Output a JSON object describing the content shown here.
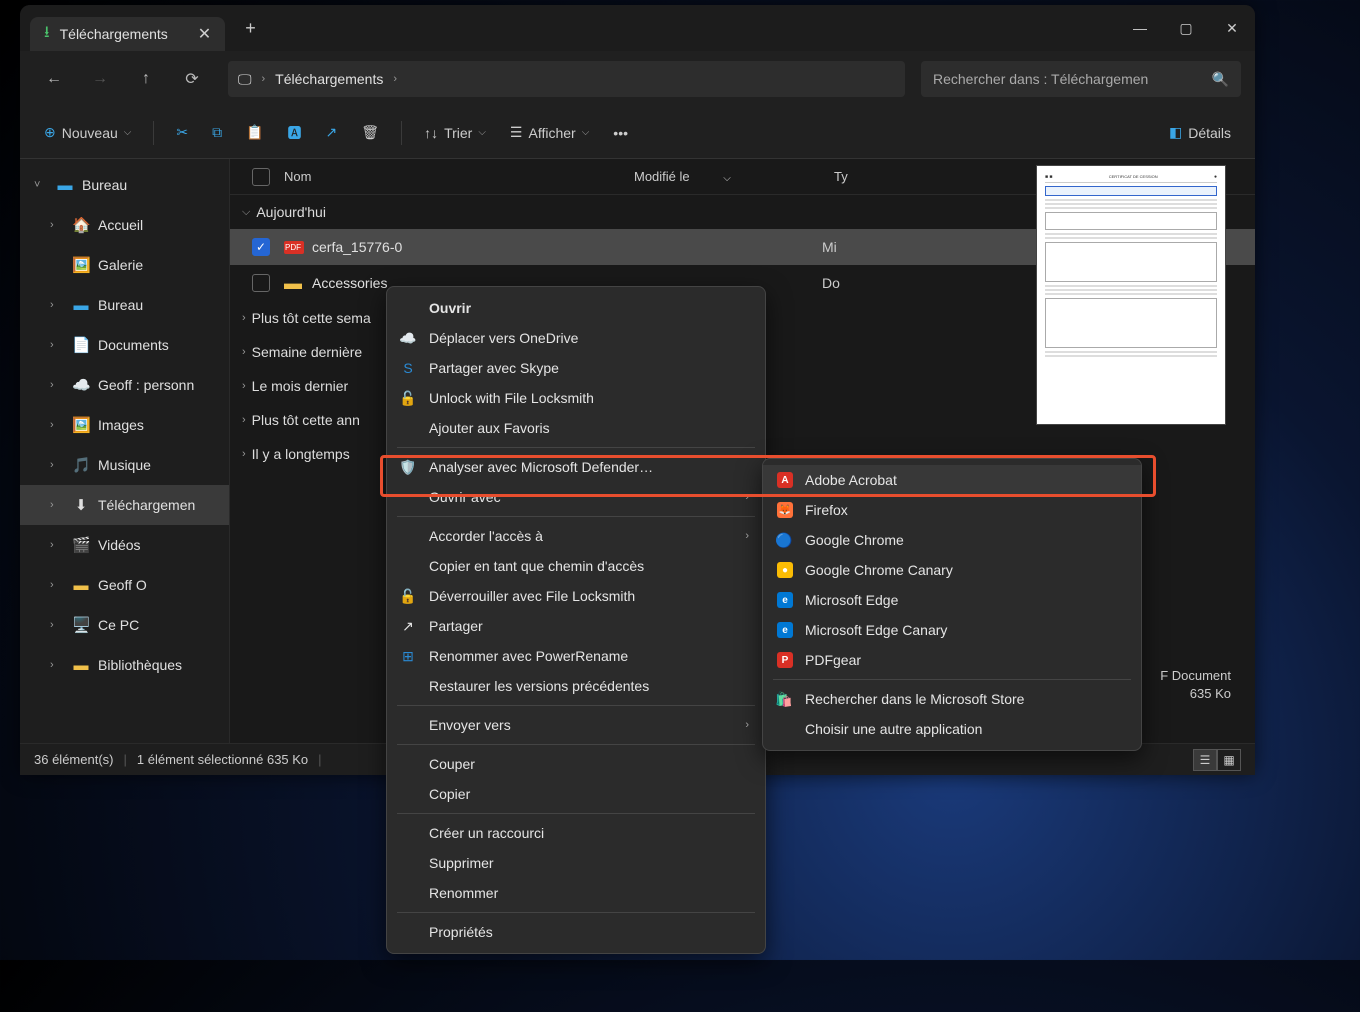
{
  "tab": {
    "title": "Téléchargements"
  },
  "breadcrumb": {
    "location": "Téléchargements"
  },
  "search": {
    "placeholder": "Rechercher dans : Téléchargemen"
  },
  "toolbar": {
    "new": "Nouveau",
    "sort": "Trier",
    "view": "Afficher",
    "details": "Détails"
  },
  "sidebar": {
    "items": [
      {
        "label": "Bureau",
        "expander": "˅",
        "color": "#3aa6e6",
        "indent": 0
      },
      {
        "label": "Accueil",
        "expander": "›",
        "icon": "🏠",
        "indent": 1
      },
      {
        "label": "Galerie",
        "expander": "",
        "icon": "🖼️",
        "indent": 1
      },
      {
        "label": "Bureau",
        "expander": "›",
        "color": "#3aa6e6",
        "indent": 1
      },
      {
        "label": "Documents",
        "expander": "›",
        "icon": "📄",
        "indent": 1
      },
      {
        "label": "Geoff : personn",
        "expander": "›",
        "icon": "☁️",
        "indent": 1
      },
      {
        "label": "Images",
        "expander": "›",
        "icon": "🖼️",
        "indent": 1
      },
      {
        "label": "Musique",
        "expander": "›",
        "icon": "🎵",
        "indent": 1
      },
      {
        "label": "Téléchargemen",
        "expander": "›",
        "icon": "⬇",
        "selected": true,
        "indent": 1
      },
      {
        "label": "Vidéos",
        "expander": "›",
        "icon": "🎬",
        "indent": 1
      },
      {
        "label": "Geoff O",
        "expander": "›",
        "color": "#f0c04a",
        "indent": 1
      },
      {
        "label": "Ce PC",
        "expander": "›",
        "icon": "🖥️",
        "indent": 1
      },
      {
        "label": "Bibliothèques",
        "expander": "›",
        "color": "#f0c04a",
        "indent": 1
      }
    ]
  },
  "columns": {
    "name": "Nom",
    "modified": "Modifié le",
    "type": "Ty"
  },
  "groups": [
    "Aujourd'hui",
    "Plus tôt cette sema",
    "Semaine dernière",
    "Le mois dernier",
    "Plus tôt cette ann",
    "Il y a longtemps"
  ],
  "files": [
    {
      "name": "cerfa_15776-0",
      "type": "Mi",
      "selected": true,
      "icon": "pdf"
    },
    {
      "name": "Accessories",
      "type": "Do",
      "icon": "folder"
    }
  ],
  "preview": {
    "type_label": "F Document",
    "size_label": "635 Ko"
  },
  "status": {
    "count": "36 élément(s)",
    "selection": "1 élément sélectionné  635 Ko"
  },
  "context_menu": [
    {
      "label": "Ouvrir",
      "bold": true
    },
    {
      "label": "Déplacer vers OneDrive",
      "icon": "☁️",
      "iconColor": "#2a8ad4"
    },
    {
      "label": "Partager avec Skype",
      "icon": "S",
      "iconColor": "#2a8ad4"
    },
    {
      "label": "Unlock with File Locksmith",
      "icon": "🔓"
    },
    {
      "label": "Ajouter aux Favoris"
    },
    {
      "sep": true
    },
    {
      "label": "Analyser avec Microsoft Defender…",
      "icon": "🛡️",
      "iconColor": "#2a8ad4"
    },
    {
      "label": "Ouvrir avec",
      "arrow": true
    },
    {
      "sep": true
    },
    {
      "label": "Accorder l'accès à",
      "arrow": true
    },
    {
      "label": "Copier en tant que chemin d'accès"
    },
    {
      "label": "Déverrouiller avec File Locksmith",
      "icon": "🔓"
    },
    {
      "label": "Partager",
      "icon": "↗"
    },
    {
      "label": "Renommer avec PowerRename",
      "icon": "⊞",
      "iconColor": "#2a8ad4"
    },
    {
      "label": "Restaurer les versions précédentes"
    },
    {
      "sep": true
    },
    {
      "label": "Envoyer vers",
      "arrow": true
    },
    {
      "sep": true
    },
    {
      "label": "Couper"
    },
    {
      "label": "Copier"
    },
    {
      "sep": true
    },
    {
      "label": "Créer un raccourci"
    },
    {
      "label": "Supprimer"
    },
    {
      "label": "Renommer"
    },
    {
      "sep": true
    },
    {
      "label": "Propriétés"
    }
  ],
  "submenu": [
    {
      "label": "Adobe Acrobat",
      "highlight": true,
      "icon": "acrobat"
    },
    {
      "label": "Firefox",
      "icon": "firefox"
    },
    {
      "label": "Google Chrome",
      "icon": "chrome"
    },
    {
      "label": "Google Chrome Canary",
      "icon": "canary"
    },
    {
      "label": "Microsoft Edge",
      "icon": "edge"
    },
    {
      "label": "Microsoft Edge Canary",
      "icon": "edgecan"
    },
    {
      "label": "PDFgear",
      "icon": "pdfgear"
    },
    {
      "sep": true
    },
    {
      "label": "Rechercher dans le Microsoft Store",
      "icon": "store"
    },
    {
      "label": "Choisir une autre application"
    }
  ]
}
